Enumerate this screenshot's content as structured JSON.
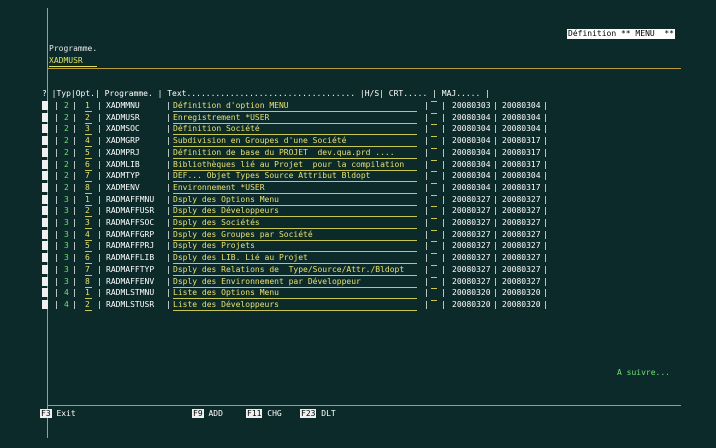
{
  "header": {
    "title": "Définition ** MENU  **"
  },
  "program": {
    "label": "Programme.",
    "value": "XADMUSR"
  },
  "table": {
    "header": "? |Typ|Opt.| Programme. | Text................................... |H/S| CRT..... | MAJ..... |",
    "rows": [
      {
        "typ": "2",
        "opt": "1",
        "prog": "XADMMNU",
        "text": "Définition d'option MENU",
        "crt": "20080303",
        "maj": "20080304"
      },
      {
        "typ": "2",
        "opt": "2",
        "prog": "XADMUSR",
        "text": "Enregistrement *USER",
        "crt": "20080304",
        "maj": "20080304"
      },
      {
        "typ": "2",
        "opt": "3",
        "prog": "XADMSOC",
        "text": "Définition Société",
        "crt": "20080304",
        "maj": "20080304"
      },
      {
        "typ": "2",
        "opt": "4",
        "prog": "XADMGRP",
        "text": "Subdivision en Groupes d'une Société",
        "crt": "20080304",
        "maj": "20080317"
      },
      {
        "typ": "2",
        "opt": "5",
        "prog": "XADMPRJ",
        "text": "Définition de base du PROJET  dev.qua.prd ....",
        "crt": "20080304",
        "maj": "20080317"
      },
      {
        "typ": "2",
        "opt": "6",
        "prog": "XADMLIB",
        "text": "Bibliothèques lié au Projet  pour la compilation",
        "crt": "20080304",
        "maj": "20080317"
      },
      {
        "typ": "2",
        "opt": "7",
        "prog": "XADMTYP",
        "text": "DEF... Objet Types Source Attribut Bldopt",
        "crt": "20080304",
        "maj": "20080304"
      },
      {
        "typ": "2",
        "opt": "8",
        "prog": "XADMENV",
        "text": "Environnement *USER",
        "crt": "20080304",
        "maj": "20080317"
      },
      {
        "typ": "3",
        "opt": "1",
        "prog": "RADMAFFMNU",
        "text": "Dsply des Options Menu",
        "crt": "20080327",
        "maj": "20080327"
      },
      {
        "typ": "3",
        "opt": "2",
        "prog": "RADMAFFUSR",
        "text": "Dsply des Développeurs",
        "crt": "20080327",
        "maj": "20080327"
      },
      {
        "typ": "3",
        "opt": "3",
        "prog": "RADMAFFSOC",
        "text": "Dsply des Sociétés",
        "crt": "20080327",
        "maj": "20080327"
      },
      {
        "typ": "3",
        "opt": "4",
        "prog": "RADMAFFGRP",
        "text": "Dsply des Groupes par Société",
        "crt": "20080327",
        "maj": "20080327"
      },
      {
        "typ": "3",
        "opt": "5",
        "prog": "RADMAFFPRJ",
        "text": "Dsply des Projets",
        "crt": "20080327",
        "maj": "20080327"
      },
      {
        "typ": "3",
        "opt": "6",
        "prog": "RADMAFFLIB",
        "text": "Dsply des LIB. Lié au Projet",
        "crt": "20080327",
        "maj": "20080327"
      },
      {
        "typ": "3",
        "opt": "7",
        "prog": "RADMAFFTYP",
        "text": "Dsply des Relations de  Type/Source/Attr./Bldopt",
        "crt": "20080327",
        "maj": "20080327"
      },
      {
        "typ": "3",
        "opt": "8",
        "prog": "RADMAFFENV",
        "text": "Dsply des Environnement par Développeur",
        "crt": "20080327",
        "maj": "20080327"
      },
      {
        "typ": "4",
        "opt": "1",
        "prog": "RADMLSTMNU",
        "text": "Liste des Options Menu",
        "crt": "20080320",
        "maj": "20080320"
      },
      {
        "typ": "4",
        "opt": "2",
        "prog": "RADMLSTUSR",
        "text": "Liste des Développeurs",
        "crt": "20080320",
        "maj": "20080320"
      }
    ],
    "more": "A suivre..."
  },
  "fkeys": [
    {
      "key": "F3",
      "label": "Exit"
    },
    {
      "key": "F9",
      "label": "ADD"
    },
    {
      "key": "F11",
      "label": "CHG"
    },
    {
      "key": "F23",
      "label": "DLT"
    }
  ],
  "colors": {
    "background": "#0c2a2a",
    "text_green": "#6ee06e",
    "text_yellow": "#e8e070"
  }
}
